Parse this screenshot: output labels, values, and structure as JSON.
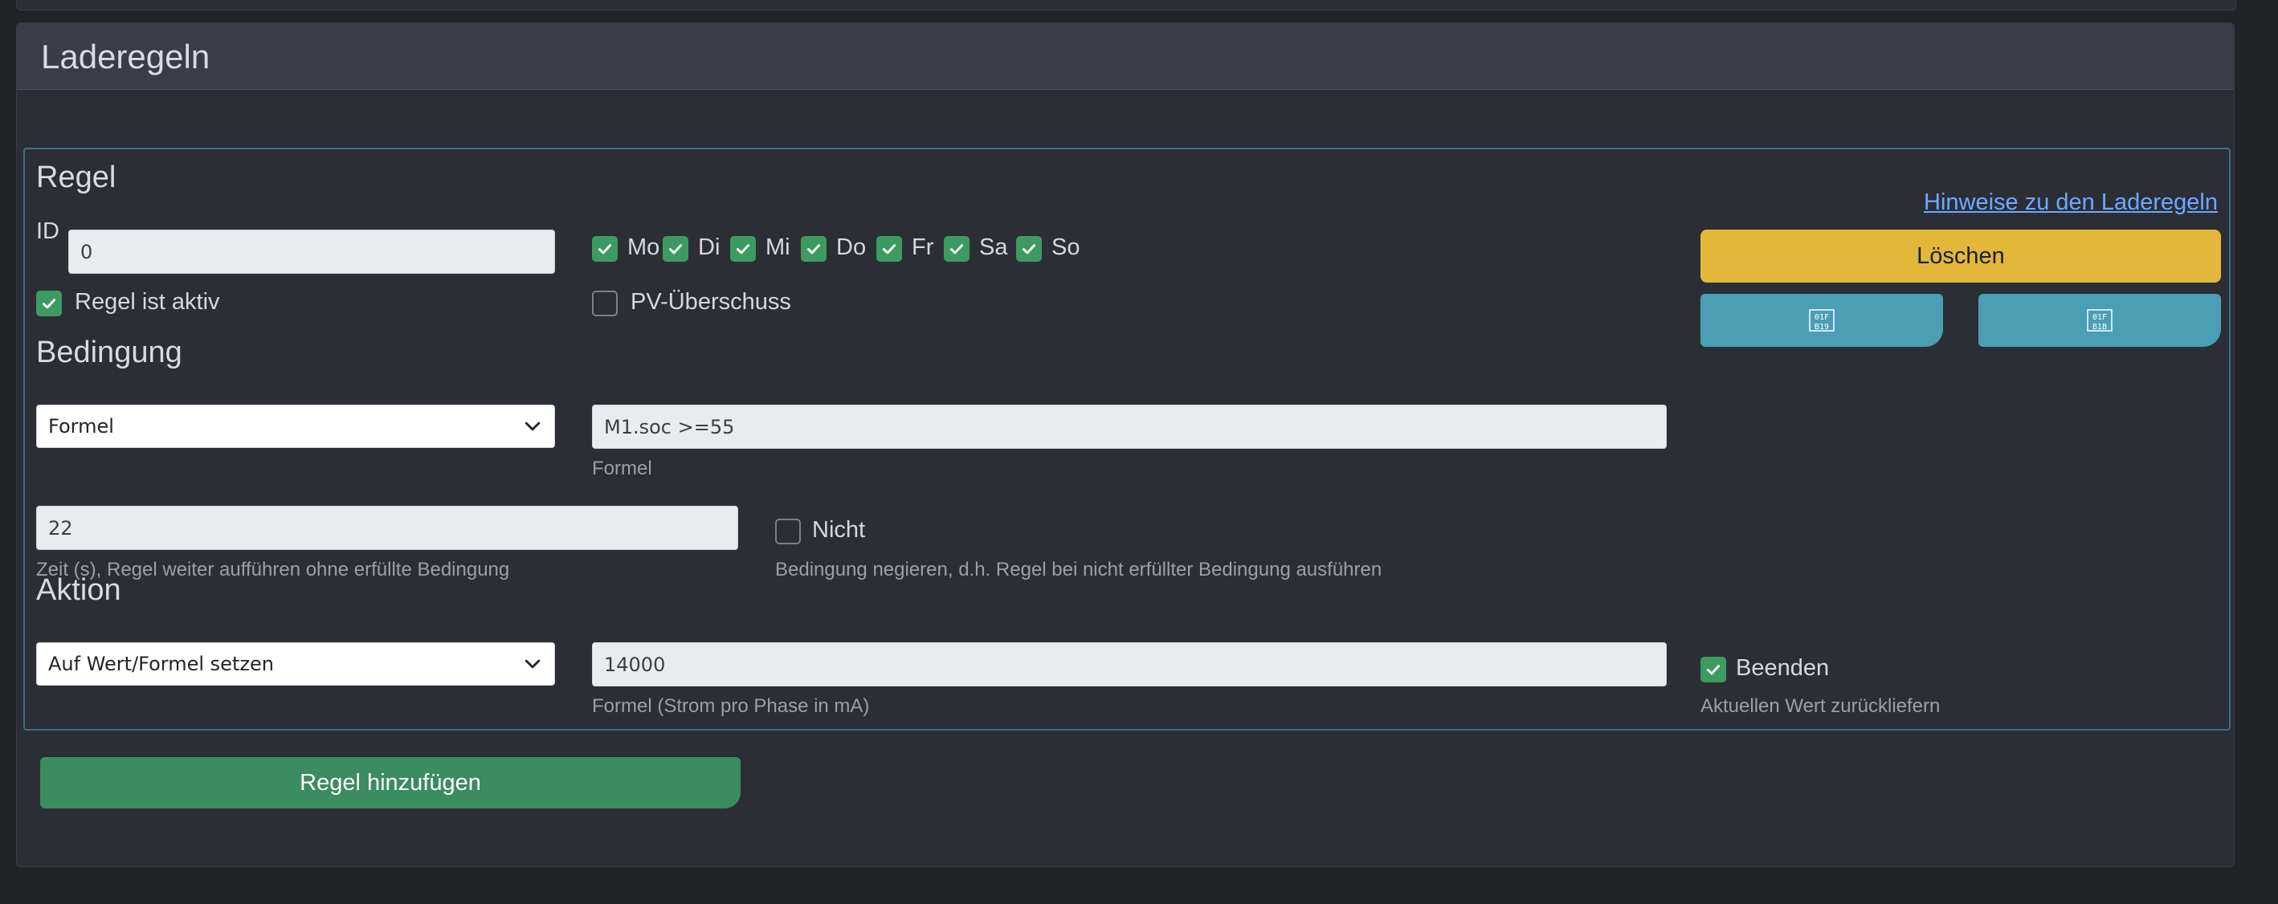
{
  "card": {
    "title": "Laderegeln"
  },
  "rule": {
    "heading": "Regel",
    "help_link": "Hinweise zu den Laderegeln",
    "id_label": "ID",
    "id_value": "0",
    "active_label": "Regel ist aktiv",
    "active_checked": true,
    "days": [
      {
        "label": "Mo",
        "checked": true
      },
      {
        "label": "Di",
        "checked": true
      },
      {
        "label": "Mi",
        "checked": true
      },
      {
        "label": "Do",
        "checked": true
      },
      {
        "label": "Fr",
        "checked": true
      },
      {
        "label": "Sa",
        "checked": true
      },
      {
        "label": "So",
        "checked": true
      }
    ],
    "pv_label": "PV-Überschuss",
    "pv_checked": false,
    "delete_label": "Löschen"
  },
  "condition": {
    "heading": "Bedingung",
    "type_value": "Formel",
    "formula_value": "M1.soc >=55",
    "formula_help": "Formel",
    "time_value": "22",
    "time_help": "Zeit (s), Regel weiter aufführen ohne erfüllte Bedingung",
    "not_label": "Nicht",
    "not_checked": false,
    "not_help": "Bedingung negieren, d.h. Regel bei nicht erfüllter Bedingung ausführen"
  },
  "action": {
    "heading": "Aktion",
    "type_value": "Auf Wert/Formel setzen",
    "formula_value": "14000",
    "formula_help": "Formel (Strom pro Phase in mA)",
    "end_label": "Beenden",
    "end_checked": true,
    "end_help": "Aktuellen Wert zurückliefern"
  },
  "add_rule_label": "Regel hinzufügen",
  "colors": {
    "accent_green": "#3b8c5e",
    "checkbox_green": "#3d9b62",
    "warning_yellow": "#e3b83a",
    "info_teal": "#4a9fb5",
    "link_blue": "#6ea8fe",
    "border_teal": "#3f6e82"
  },
  "icons": {
    "export": "qr-binary-icon",
    "import": "qr-binary-icon",
    "select": "chevron-down-icon",
    "checkbox": "check-icon"
  }
}
